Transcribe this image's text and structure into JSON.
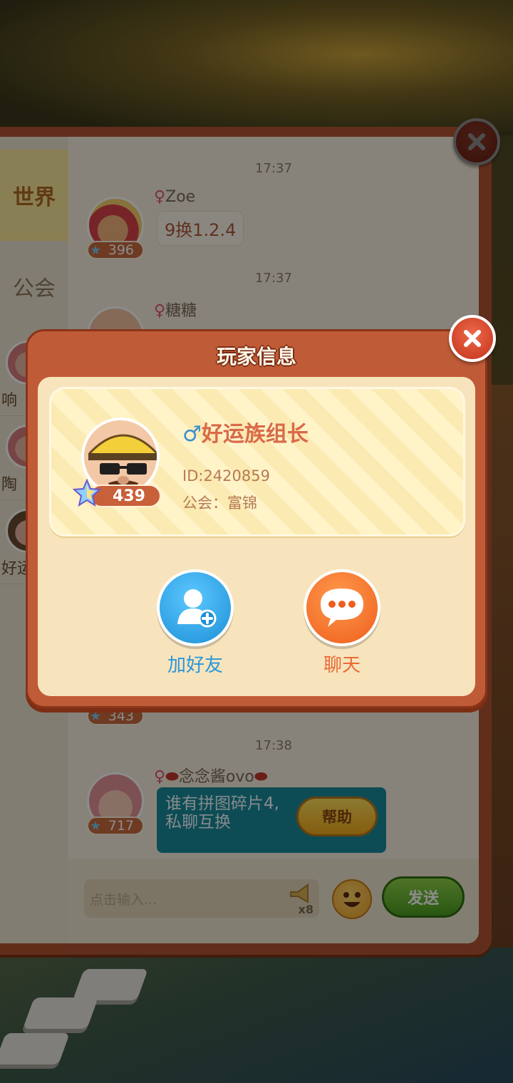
{
  "chat": {
    "tabs": [
      "世界",
      "公会"
    ],
    "sidebar_friends": [
      "响",
      "陶",
      "好运"
    ],
    "messages": [
      {
        "time": "17:37",
        "name": "Zoe",
        "gender": "♀",
        "level": "396",
        "text": "9换1.2.4"
      },
      {
        "time": "17:37",
        "name": "糖糖",
        "gender": "♀",
        "level": "",
        "text": ""
      },
      {
        "time": "",
        "name": "",
        "gender": "",
        "level": "343",
        "text": ""
      },
      {
        "time": "17:38",
        "name": "念念酱ovo",
        "gender": "♀",
        "level": "717",
        "text": "谁有拼图碎片4,\n私聊互换",
        "action": "帮助"
      }
    ],
    "input_placeholder": "点击输入...",
    "speaker_count": "x8",
    "send_label": "发送"
  },
  "modal": {
    "title": "玩家信息",
    "player": {
      "gender_symbol": "♂",
      "name": "好运族组长",
      "level": "439",
      "id_text": "ID:2420859",
      "guild_text": "公会：富锦"
    },
    "actions": {
      "add_friend": "加好友",
      "chat": "聊天"
    }
  },
  "colors": {
    "panel_red": "#c05b38",
    "card_cream": "#f7e4bd",
    "add_friend_blue": "#1f9fe0",
    "chat_orange": "#f26a2c",
    "male_blue": "#3a8fd1",
    "female_pink": "#e0547a"
  },
  "icons": [
    "close-icon",
    "star-icon",
    "add-user-icon",
    "chat-bubble-icon",
    "speaker-icon",
    "emoji-icon"
  ]
}
